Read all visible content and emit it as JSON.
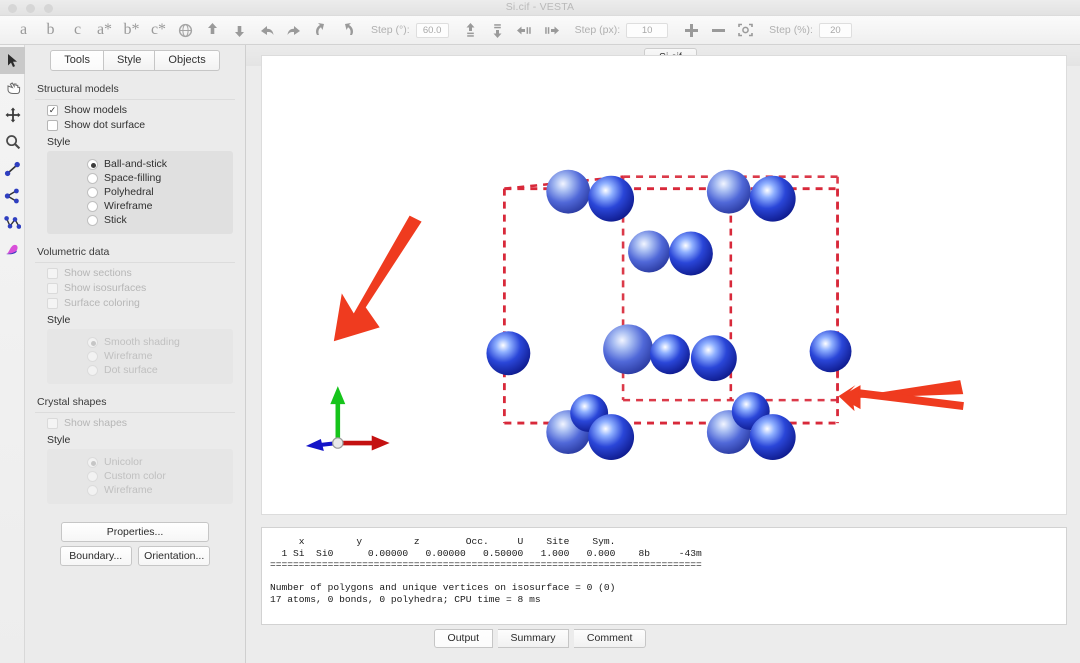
{
  "window": {
    "title": "Si.cif - VESTA"
  },
  "toolbar": {
    "axis_buttons": [
      "a",
      "b",
      "c",
      "a*",
      "b*",
      "c*"
    ],
    "globe_icon": "globe-icon",
    "rotate_icons": [
      "rotate-up-icon",
      "rotate-down-icon",
      "rotate-left-icon",
      "rotate-right-icon",
      "rotate-ccw-icon",
      "rotate-cw-icon"
    ],
    "step_deg_label": "Step (°):",
    "step_deg_value": "60.0",
    "translate_icons": [
      "translate-up-icon",
      "translate-down-icon",
      "translate-left-icon",
      "translate-right-icon"
    ],
    "step_px_label": "Step (px):",
    "step_px_value": "10",
    "zoom_in_icon": "zoom-in-icon",
    "zoom_out_icon": "zoom-out-icon",
    "fit_icon": "fit-to-screen-icon",
    "step_pct_label": "Step (%):",
    "step_pct_value": "20"
  },
  "rail": {
    "items": [
      {
        "name": "select-tool",
        "active": true
      },
      {
        "name": "hand-tool",
        "active": false
      },
      {
        "name": "move-tool",
        "active": false
      },
      {
        "name": "zoom-tool",
        "active": false
      },
      {
        "name": "bond-distance-tool",
        "active": false
      },
      {
        "name": "bond-angle-tool",
        "active": false
      },
      {
        "name": "dihedral-angle-tool",
        "active": false
      },
      {
        "name": "isosurface-tool",
        "active": false
      }
    ]
  },
  "panel": {
    "tabs": [
      {
        "label": "Tools",
        "selected": true
      },
      {
        "label": "Style",
        "selected": false
      },
      {
        "label": "Objects",
        "selected": false
      }
    ],
    "structural_models": {
      "title": "Structural models",
      "checkboxes": [
        {
          "label": "Show models",
          "checked": true,
          "enabled": true
        },
        {
          "label": "Show dot surface",
          "checked": false,
          "enabled": true
        }
      ],
      "style_label": "Style",
      "style_options": [
        {
          "label": "Ball-and-stick",
          "selected": true
        },
        {
          "label": "Space-filling",
          "selected": false
        },
        {
          "label": "Polyhedral",
          "selected": false
        },
        {
          "label": "Wireframe",
          "selected": false
        },
        {
          "label": "Stick",
          "selected": false
        }
      ]
    },
    "volumetric_data": {
      "title": "Volumetric data",
      "enabled": false,
      "checkboxes": [
        {
          "label": "Show sections",
          "checked": false
        },
        {
          "label": "Show isosurfaces",
          "checked": false
        },
        {
          "label": "Surface coloring",
          "checked": false
        }
      ],
      "style_label": "Style",
      "style_options": [
        {
          "label": "Smooth shading",
          "selected": true
        },
        {
          "label": "Wireframe",
          "selected": false
        },
        {
          "label": "Dot surface",
          "selected": false
        }
      ]
    },
    "crystal_shapes": {
      "title": "Crystal shapes",
      "enabled": false,
      "checkboxes": [
        {
          "label": "Show shapes",
          "checked": false
        }
      ],
      "style_label": "Style",
      "style_options": [
        {
          "label": "Unicolor",
          "selected": true
        },
        {
          "label": "Custom color",
          "selected": false
        },
        {
          "label": "Wireframe",
          "selected": false
        }
      ]
    },
    "buttons": {
      "properties": "Properties...",
      "boundary": "Boundary...",
      "orientation": "Orientation..."
    }
  },
  "document": {
    "tab_label": "Si.cif"
  },
  "viewport": {
    "structure_name": "silicon-crystal-structure",
    "atom_color": "#1633cc",
    "unit_cell_color": "#dd2222",
    "axes": {
      "a_axis_color": "#0000cc",
      "b_axis_color": "#cc0000",
      "c_axis_color": "#00cc00"
    },
    "annotations": [
      {
        "name": "annotation-arrow-left",
        "color": "#e8381c"
      },
      {
        "name": "annotation-arrow-right",
        "color": "#e8381c"
      }
    ]
  },
  "console": {
    "text": "     x         y         z        Occ.     U    Site    Sym.\n  1 Si  Si0      0.00000   0.00000   0.50000   1.000   0.000    8b     -43m\n===========================================================================\n\nNumber of polygons and unique vertices on isosurface = 0 (0)\n17 atoms, 0 bonds, 0 polyhedra; CPU time = 8 ms"
  },
  "bottom_tabs": [
    {
      "label": "Output",
      "selected": true
    },
    {
      "label": "Summary",
      "selected": false
    },
    {
      "label": "Comment",
      "selected": false
    }
  ]
}
